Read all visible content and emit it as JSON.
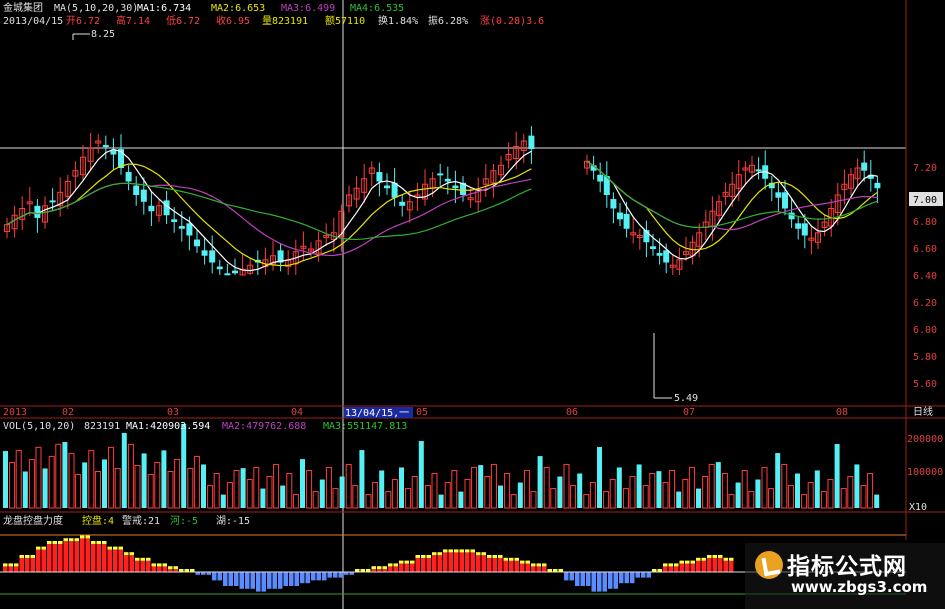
{
  "header": {
    "name": "金城集团",
    "ma_label": "MA(5,10,20,30)",
    "ma1": "MA1:6.734",
    "ma2": "MA2:6.653",
    "ma3": "MA3:6.499",
    "ma4": "MA4:6.535",
    "date": "2013/04/15",
    "open": "开6.72",
    "high": "高7.14",
    "low": "低6.72",
    "close": "收6.95",
    "volume": "量823191",
    "amount": "额57110",
    "turnover": "换1.84%",
    "amplitude": "振6.28%",
    "change": "涨(0.28)3.6"
  },
  "price_axis": {
    "ticks": [
      "7.20",
      "7.00",
      "6.80",
      "6.60",
      "6.40",
      "6.20",
      "6.00",
      "5.80",
      "5.60"
    ],
    "current": "7.00"
  },
  "annotations": {
    "max": "8.25",
    "min": "5.49"
  },
  "time_axis": {
    "labels": [
      "2013",
      "02",
      "03",
      "04",
      "05",
      "06",
      "07",
      "08"
    ],
    "cursor": "13/04/15,一",
    "period": "日线"
  },
  "volume_panel": {
    "label": "VOL(5,10,20)",
    "value": "823191",
    "ma1": "MA1:420903.594",
    "ma2": "MA2:479762.688",
    "ma3": "MA3:551147.813",
    "ticks": [
      "200000",
      "100000"
    ],
    "unit": "X10"
  },
  "indicator_panel": {
    "label": "龙盘控盘力度",
    "kongpan": "控盘:4",
    "zhengzhao": "警戒:21",
    "he": "河:-5",
    "hu": "湖:-15"
  },
  "watermark": {
    "title": "指标公式网",
    "url": "www.zbgs3.com"
  },
  "colors": {
    "up": "#ff3c3c",
    "down": "#54f0f4",
    "ma1": "#ffffff",
    "ma2": "#e5e500",
    "ma3": "#c040c0",
    "ma4": "#30b030",
    "red_bar": "#ff2020",
    "yellow_bar": "#ffff40",
    "blue_bar": "#5b8cff"
  },
  "chart_data": {
    "type": "candlestick",
    "price_ylim": [
      5.45,
      7.35
    ],
    "annotated_max": 8.25,
    "annotated_min": 5.49,
    "left_segment_prices": [
      6.78,
      6.85,
      6.9,
      6.95,
      6.83,
      6.92,
      6.95,
      7.02,
      7.1,
      7.18,
      7.28,
      7.35,
      7.4,
      7.36,
      7.3,
      7.2,
      7.1,
      7.0,
      6.95,
      6.88,
      6.92,
      6.85,
      6.8,
      6.75,
      6.7,
      6.62,
      6.55,
      6.5,
      6.45,
      6.4,
      6.42,
      6.45,
      6.48,
      6.5,
      6.52,
      6.55,
      6.5,
      6.52,
      6.58,
      6.62,
      6.6,
      6.66,
      6.7,
      6.72,
      6.88,
      7.0,
      7.05,
      7.12,
      7.2,
      7.1,
      7.05,
      6.98,
      6.92,
      6.95,
      7.0,
      7.08,
      7.12,
      7.15,
      7.1,
      7.05,
      7.0,
      6.98,
      7.04,
      7.12,
      7.18,
      7.22,
      7.3,
      7.36,
      7.4,
      7.34
    ],
    "right_segment_prices": [
      7.25,
      7.18,
      7.1,
      7.0,
      6.9,
      6.82,
      6.75,
      6.72,
      6.7,
      6.65,
      6.6,
      6.55,
      6.5,
      6.48,
      6.52,
      6.58,
      6.65,
      6.72,
      6.8,
      6.88,
      6.95,
      7.02,
      7.08,
      7.15,
      7.2,
      7.22,
      7.18,
      7.12,
      7.05,
      6.98,
      6.9,
      6.82,
      6.75,
      6.7,
      6.68,
      6.72,
      6.8,
      6.9,
      7.0,
      7.08,
      7.15,
      7.2,
      7.18,
      7.12,
      7.05
    ],
    "volume_ticks": [
      100000,
      200000
    ],
    "indicator_values": [
      2,
      5,
      8,
      10,
      11,
      12,
      10,
      8,
      6,
      4,
      2,
      1,
      0,
      -1,
      -3,
      -5,
      -6,
      -7,
      -6,
      -5,
      -4,
      -3,
      -2,
      -1,
      0,
      1,
      2,
      3,
      5,
      6,
      7,
      7,
      6,
      5,
      4,
      3,
      2,
      0,
      -3,
      -5,
      -7,
      -6,
      -4,
      -2,
      0,
      2,
      3,
      4,
      5,
      4,
      3
    ]
  }
}
